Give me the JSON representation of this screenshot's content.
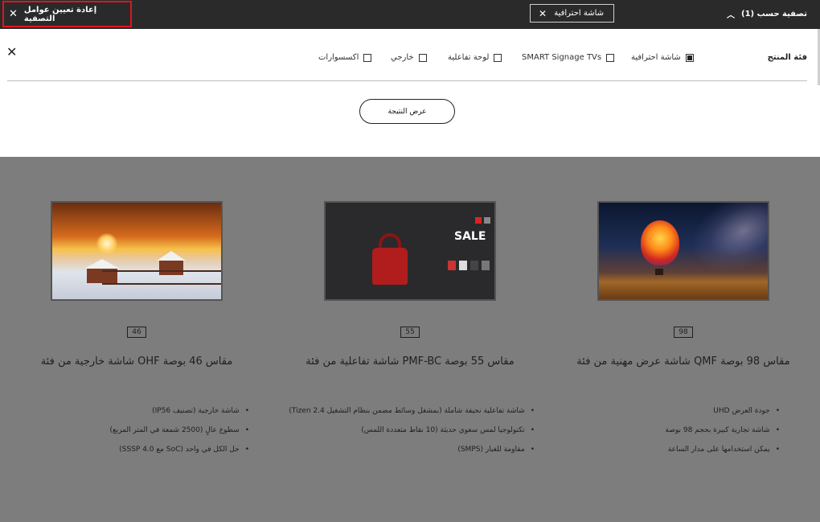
{
  "topbar": {
    "reset_label": "إعادة تعيين عوامل التصفية",
    "active_chip_label": "شاشة احترافية",
    "filter_by_label": "تصفية حسب (1)"
  },
  "filter_panel": {
    "category_label": "فئة المنتج",
    "options": [
      {
        "label": "شاشة احترافية",
        "checked": true
      },
      {
        "label": "SMART Signage TVs",
        "checked": false
      },
      {
        "label": "لوحة تفاعلية",
        "checked": false
      },
      {
        "label": "خارجي",
        "checked": false
      },
      {
        "label": "اكسسوارات",
        "checked": false
      }
    ],
    "show_results_label": "عرض النتيجة"
  },
  "products": [
    {
      "size": "46",
      "title": "شاشة خارجية من فئة OHF مقاس 46 بوصة",
      "features": [
        "شاشة خارجية (تصنيف IP56)",
        "سطوع عالٍ (2500 شمعة في المتر المربع)",
        "حل الكل في واحد (SoC مع SSSP 4.0)"
      ]
    },
    {
      "size": "55",
      "title": "شاشة تفاعلية من فئة PMF-BC مقاس 55 بوصة",
      "features": [
        "شاشة تفاعلية نحيفة شاملة (بمشغل وسائط مضمن بنظام التشغيل Tizen 2.4)",
        "تكنولوجيا لمس سعوي حديثة (10 نقاط متعددة اللمس)",
        "مقاومة للغبار (SMPS)"
      ],
      "image_text": "SALE"
    },
    {
      "size": "98",
      "title": "شاشة عرض مهنية من فئة QMF مقاس 98 بوصة",
      "features": [
        "جودة العرض UHD",
        "شاشة تجارية كبيرة بحجم 98 بوصة",
        "يمكن استخدامها على مدار الساعة"
      ]
    }
  ],
  "colors": {
    "topbar": "#2a2a2a",
    "reset_highlight": "#e0141e",
    "overlay": "#7d7d7d"
  },
  "icons": {
    "close": "close-icon",
    "chevron": "chevron-up-icon"
  }
}
